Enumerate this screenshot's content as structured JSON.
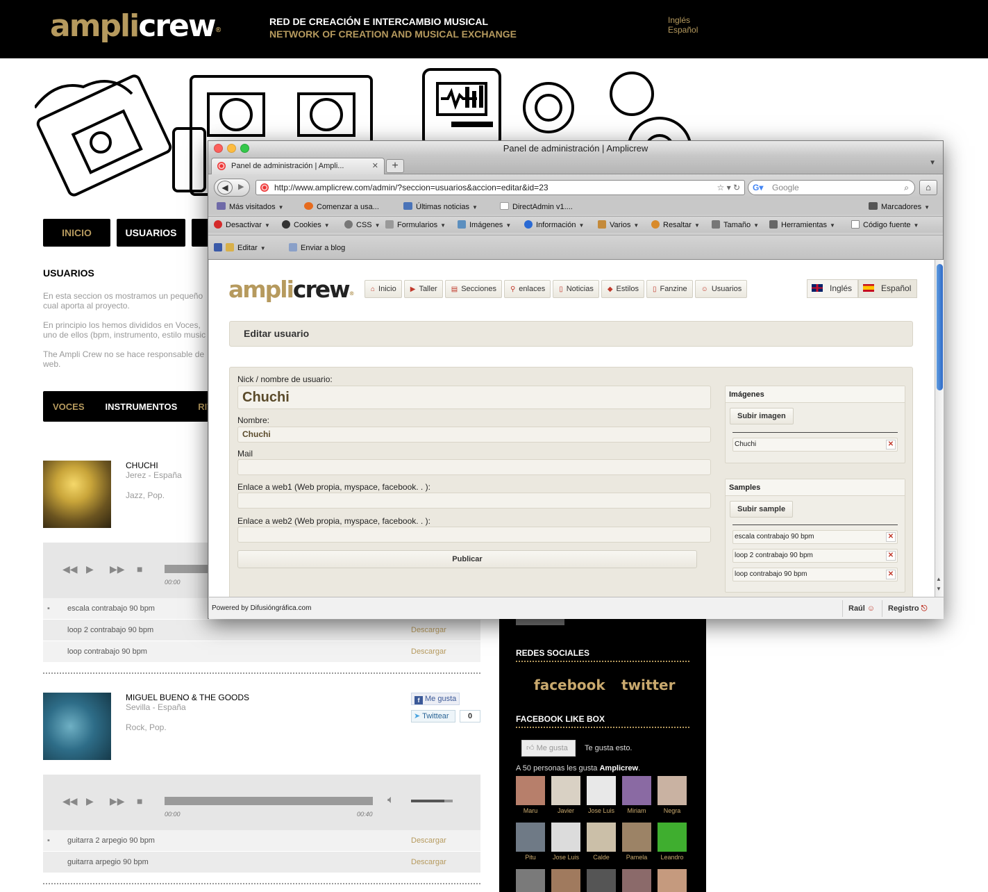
{
  "site": {
    "logo_a": "ampli",
    "logo_b": "crew",
    "logo_reg": "®",
    "tagline_es": "RED DE CREACIÓN E INTERCAMBIO MUSICAL",
    "tagline_en": "NETWORK OF CREATION AND MUSICAL EXCHANGE",
    "lang_en": "Inglés",
    "lang_es": "Español",
    "nav": [
      "INICIO",
      "USUARIOS",
      ""
    ],
    "section_title": "USUARIOS",
    "intro": [
      "En esta seccion os mostramos un pequeño cual aporta al proyecto.",
      "En principio los hemos divididos en Voces, uno de ellos (bpm, instrumento, estilo music",
      "The Ampli Crew no se hace responsable de web."
    ],
    "categories": [
      "VOCES",
      "INSTRUMENTOS",
      "RIT"
    ],
    "users": [
      {
        "name": "CHUCHI",
        "location": "Jerez - España",
        "genre": "Jazz, Pop.",
        "player": {
          "start": "00:00",
          "end": "",
          "progress": 0
        },
        "tracks": [
          {
            "name": "escala contrabajo 90 bpm",
            "download": ""
          },
          {
            "name": "loop 2 contrabajo 90 bpm",
            "download": "Descargar"
          },
          {
            "name": "loop contrabajo 90 bpm",
            "download": "Descargar"
          }
        ]
      },
      {
        "name": "MIGUEL BUENO & THE GOODS",
        "location": "Sevilla - España",
        "genre": "Rock, Pop.",
        "player": {
          "start": "00:00",
          "end": "00:40",
          "progress": 0,
          "volume": 0.8
        },
        "tracks": [
          {
            "name": "guitarra 2 arpegio 90 bpm",
            "download": "Descargar"
          },
          {
            "name": "guitarra arpegio 90 bpm",
            "download": "Descargar"
          }
        ]
      }
    ],
    "social_buttons": {
      "like": "Me gusta",
      "tweet": "Twittear",
      "tweet_count": "0"
    },
    "sidebar": {
      "redes_title": "REDES SOCIALES",
      "facebook": "facebook",
      "twitter": "twitter",
      "likebox_title": "FACEBOOK LIKE BOX",
      "like_button": "Me gusta",
      "like_text": "Te gusta esto.",
      "like_count_prefix": "A 50 personas les gusta ",
      "like_count_page": "Amplicrew",
      "like_count_suffix": ".",
      "faces": [
        "Maru",
        "Javier",
        "Jose Luis",
        "Miriam",
        "Negra",
        "Pitu",
        "Jose Luis",
        "Calde",
        "Pamela",
        "Leandro"
      ]
    }
  },
  "browser": {
    "window_title": "Panel de administración | Amplicrew",
    "tab_title": "Panel de administración | Ampli...",
    "url": "http://www.amplicrew.com/admin/?seccion=usuarios&accion=editar&id=23",
    "search_placeholder": "Google",
    "bookmarks": [
      "Más visitados",
      "Comenzar a usa...",
      "Últimas noticias",
      "DirectAdmin v1....",
      "Marcadores"
    ],
    "dev_toolbar": [
      "Desactivar",
      "Cookies",
      "CSS",
      "Formularios",
      "Imágenes",
      "Información",
      "Varios",
      "Resaltar",
      "Tamaño",
      "Herramientas",
      "Código fuente"
    ],
    "extra_toolbar": [
      "Editar",
      "Enviar a blog"
    ],
    "status_powered": "Powered by Difusióngráfica.com",
    "status_user": "Raúl",
    "status_register": "Registro"
  },
  "admin": {
    "logo_a": "ampli",
    "logo_b": "crew",
    "logo_reg": "®",
    "menu": [
      "Inicio",
      "Taller",
      "Secciones",
      "enlaces",
      "Noticias",
      "Estilos",
      "Fanzine",
      "Usuarios"
    ],
    "lang_en": "Inglés",
    "lang_es": "Español",
    "edit_title": "Editar usuario",
    "form": {
      "nick_label": "Nick / nombre de usuario:",
      "nick_value": "Chuchi",
      "name_label": "Nombre:",
      "name_value": "Chuchi",
      "mail_label": "Mail",
      "mail_value": "",
      "web1_label": "Enlace a web1 (Web propia, myspace, facebook. . ):",
      "web1_value": "",
      "web2_label": "Enlace a web2 (Web propia, myspace, facebook. . ):",
      "web2_value": "",
      "publish": "Publicar"
    },
    "images_box": {
      "title": "Imágenes",
      "upload": "Subir imagen",
      "files": [
        "Chuchi"
      ]
    },
    "samples_box": {
      "title": "Samples",
      "upload": "Subir sample",
      "files": [
        "escala contrabajo 90 bpm",
        "loop 2 contrabajo 90 bpm",
        "loop contrabajo 90 bpm"
      ]
    }
  },
  "colors": {
    "brand_gold": "#b69a5e",
    "header_black": "#000000",
    "panel_beige": "#ebe8df",
    "delete_red": "#c0392b"
  }
}
